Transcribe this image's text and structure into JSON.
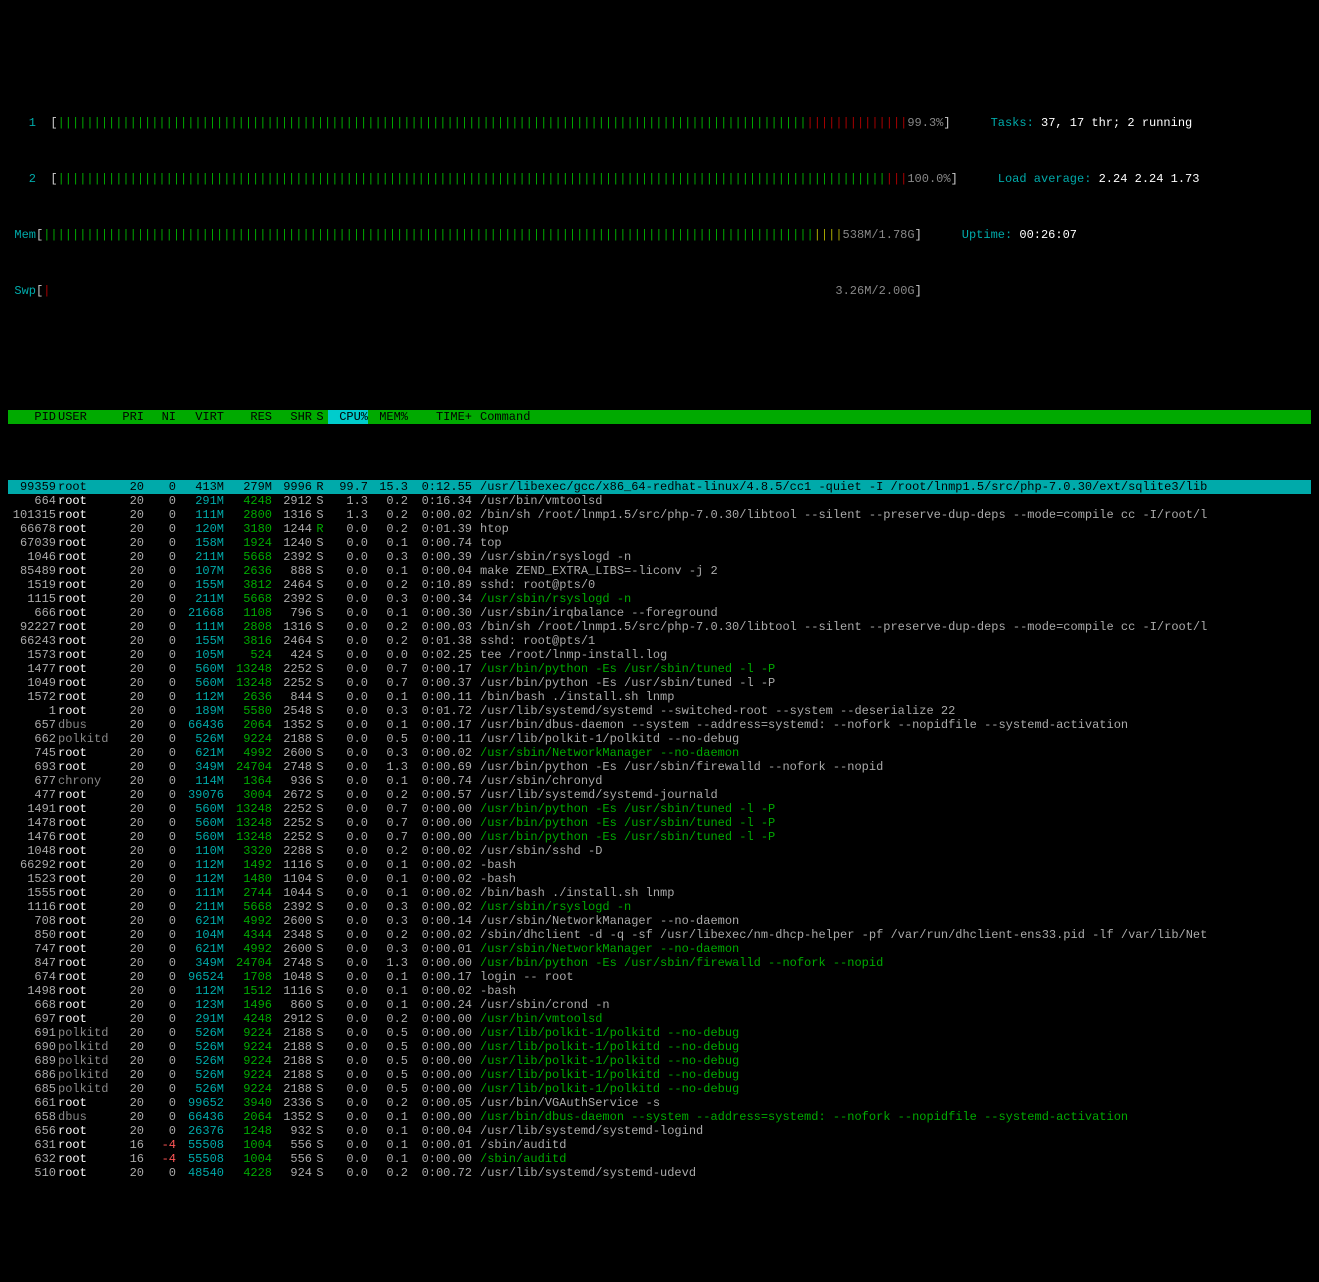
{
  "meters": {
    "cpu1": {
      "label": "1",
      "green_bars": 104,
      "red_bars": 14,
      "value": "99.3%"
    },
    "cpu2": {
      "label": "2",
      "green_bars": 115,
      "red_bars": 3,
      "value": "100.0%"
    },
    "mem": {
      "label": "Mem",
      "green_bars": 107,
      "blue_bars": 0,
      "yellow_bars": 4,
      "value": "538M/1.78G"
    },
    "swp": {
      "label": "Swp",
      "red_bars": 1,
      "value": "3.26M/2.00G"
    }
  },
  "stats": {
    "tasks": "Tasks: ",
    "tasks_val": "37, 17 thr; 2 running",
    "load": "Load average: ",
    "load_val": "2.24 2.24 1.73",
    "uptime": "Uptime: ",
    "uptime_val": "00:26:07"
  },
  "headers": [
    "PID",
    "USER",
    "PRI",
    "NI",
    "VIRT",
    "RES",
    "SHR",
    "S",
    "CPU%",
    "MEM%",
    "TIME+",
    "Command"
  ],
  "processes": [
    {
      "pid": "99359",
      "user": "root",
      "pri": "20",
      "ni": "0",
      "virt": "413M",
      "res": "279M",
      "shr": "9996",
      "s": "R",
      "cpu": "99.7",
      "mem": "15.3",
      "time": "0:12.55",
      "cmd": "/usr/libexec/gcc/x86_64-redhat-linux/4.8.5/cc1 -quiet -I /root/lnmp1.5/src/php-7.0.30/ext/sqlite3/lib",
      "cmdclass": "white",
      "selected": true
    },
    {
      "pid": "664",
      "user": "root",
      "pri": "20",
      "ni": "0",
      "virt": "291M",
      "res": "4248",
      "shr": "2912",
      "s": "S",
      "cpu": "1.3",
      "mem": "0.2",
      "time": "0:16.34",
      "cmd": "/usr/bin/vmtoolsd",
      "cmdclass": "white"
    },
    {
      "pid": "101315",
      "user": "root",
      "pri": "20",
      "ni": "0",
      "virt": "111M",
      "res": "2800",
      "shr": "1316",
      "s": "S",
      "cpu": "1.3",
      "mem": "0.2",
      "time": "0:00.02",
      "cmd": "/bin/sh /root/lnmp1.5/src/php-7.0.30/libtool --silent --preserve-dup-deps --mode=compile cc -I/root/l",
      "cmdclass": "white"
    },
    {
      "pid": "66678",
      "user": "root",
      "pri": "20",
      "ni": "0",
      "virt": "120M",
      "res": "3180",
      "shr": "1244",
      "s": "R",
      "cpu": "0.0",
      "mem": "0.2",
      "time": "0:01.39",
      "cmd": "htop",
      "cmdclass": "white",
      "running": true
    },
    {
      "pid": "67039",
      "user": "root",
      "pri": "20",
      "ni": "0",
      "virt": "158M",
      "res": "1924",
      "shr": "1240",
      "s": "S",
      "cpu": "0.0",
      "mem": "0.1",
      "time": "0:00.74",
      "cmd": "top",
      "cmdclass": "white"
    },
    {
      "pid": "1046",
      "user": "root",
      "pri": "20",
      "ni": "0",
      "virt": "211M",
      "res": "5668",
      "shr": "2392",
      "s": "S",
      "cpu": "0.0",
      "mem": "0.3",
      "time": "0:00.39",
      "cmd": "/usr/sbin/rsyslogd -n",
      "cmdclass": "white"
    },
    {
      "pid": "85489",
      "user": "root",
      "pri": "20",
      "ni": "0",
      "virt": "107M",
      "res": "2636",
      "shr": "888",
      "s": "S",
      "cpu": "0.0",
      "mem": "0.1",
      "time": "0:00.04",
      "cmd": "make ZEND_EXTRA_LIBS=-liconv -j 2",
      "cmdclass": "white"
    },
    {
      "pid": "1519",
      "user": "root",
      "pri": "20",
      "ni": "0",
      "virt": "155M",
      "res": "3812",
      "shr": "2464",
      "s": "S",
      "cpu": "0.0",
      "mem": "0.2",
      "time": "0:10.89",
      "cmd": "sshd: root@pts/0",
      "cmdclass": "white"
    },
    {
      "pid": "1115",
      "user": "root",
      "pri": "20",
      "ni": "0",
      "virt": "211M",
      "res": "5668",
      "shr": "2392",
      "s": "S",
      "cpu": "0.0",
      "mem": "0.3",
      "time": "0:00.34",
      "cmd": "/usr/sbin/rsyslogd -n",
      "cmdclass": "green"
    },
    {
      "pid": "666",
      "user": "root",
      "pri": "20",
      "ni": "0",
      "virt": "21668",
      "res": "1108",
      "shr": "796",
      "s": "S",
      "cpu": "0.0",
      "mem": "0.1",
      "time": "0:00.30",
      "cmd": "/usr/sbin/irqbalance --foreground",
      "cmdclass": "white"
    },
    {
      "pid": "92227",
      "user": "root",
      "pri": "20",
      "ni": "0",
      "virt": "111M",
      "res": "2808",
      "shr": "1316",
      "s": "S",
      "cpu": "0.0",
      "mem": "0.2",
      "time": "0:00.03",
      "cmd": "/bin/sh /root/lnmp1.5/src/php-7.0.30/libtool --silent --preserve-dup-deps --mode=compile cc -I/root/l",
      "cmdclass": "white"
    },
    {
      "pid": "66243",
      "user": "root",
      "pri": "20",
      "ni": "0",
      "virt": "155M",
      "res": "3816",
      "shr": "2464",
      "s": "S",
      "cpu": "0.0",
      "mem": "0.2",
      "time": "0:01.38",
      "cmd": "sshd: root@pts/1",
      "cmdclass": "white"
    },
    {
      "pid": "1573",
      "user": "root",
      "pri": "20",
      "ni": "0",
      "virt": "105M",
      "res": "524",
      "shr": "424",
      "s": "S",
      "cpu": "0.0",
      "mem": "0.0",
      "time": "0:02.25",
      "cmd": "tee /root/lnmp-install.log",
      "cmdclass": "white"
    },
    {
      "pid": "1477",
      "user": "root",
      "pri": "20",
      "ni": "0",
      "virt": "560M",
      "res": "13248",
      "shr": "2252",
      "s": "S",
      "cpu": "0.0",
      "mem": "0.7",
      "time": "0:00.17",
      "cmd": "/usr/bin/python -Es /usr/sbin/tuned -l -P",
      "cmdclass": "green"
    },
    {
      "pid": "1049",
      "user": "root",
      "pri": "20",
      "ni": "0",
      "virt": "560M",
      "res": "13248",
      "shr": "2252",
      "s": "S",
      "cpu": "0.0",
      "mem": "0.7",
      "time": "0:00.37",
      "cmd": "/usr/bin/python -Es /usr/sbin/tuned -l -P",
      "cmdclass": "white"
    },
    {
      "pid": "1572",
      "user": "root",
      "pri": "20",
      "ni": "0",
      "virt": "112M",
      "res": "2636",
      "shr": "844",
      "s": "S",
      "cpu": "0.0",
      "mem": "0.1",
      "time": "0:00.11",
      "cmd": "/bin/bash ./install.sh lnmp",
      "cmdclass": "white"
    },
    {
      "pid": "1",
      "user": "root",
      "pri": "20",
      "ni": "0",
      "virt": "189M",
      "res": "5580",
      "shr": "2548",
      "s": "S",
      "cpu": "0.0",
      "mem": "0.3",
      "time": "0:01.72",
      "cmd": "/usr/lib/systemd/systemd --switched-root --system --deserialize 22",
      "cmdclass": "white"
    },
    {
      "pid": "657",
      "user": "dbus",
      "pri": "20",
      "ni": "0",
      "virt": "66436",
      "res": "2064",
      "shr": "1352",
      "s": "S",
      "cpu": "0.0",
      "mem": "0.1",
      "time": "0:00.17",
      "cmd": "/usr/bin/dbus-daemon --system --address=systemd: --nofork --nopidfile --systemd-activation",
      "cmdclass": "white"
    },
    {
      "pid": "662",
      "user": "polkitd",
      "pri": "20",
      "ni": "0",
      "virt": "526M",
      "res": "9224",
      "shr": "2188",
      "s": "S",
      "cpu": "0.0",
      "mem": "0.5",
      "time": "0:00.11",
      "cmd": "/usr/lib/polkit-1/polkitd --no-debug",
      "cmdclass": "white"
    },
    {
      "pid": "745",
      "user": "root",
      "pri": "20",
      "ni": "0",
      "virt": "621M",
      "res": "4992",
      "shr": "2600",
      "s": "S",
      "cpu": "0.0",
      "mem": "0.3",
      "time": "0:00.02",
      "cmd": "/usr/sbin/NetworkManager --no-daemon",
      "cmdclass": "green"
    },
    {
      "pid": "693",
      "user": "root",
      "pri": "20",
      "ni": "0",
      "virt": "349M",
      "res": "24704",
      "shr": "2748",
      "s": "S",
      "cpu": "0.0",
      "mem": "1.3",
      "time": "0:00.69",
      "cmd": "/usr/bin/python -Es /usr/sbin/firewalld --nofork --nopid",
      "cmdclass": "white"
    },
    {
      "pid": "677",
      "user": "chrony",
      "pri": "20",
      "ni": "0",
      "virt": "114M",
      "res": "1364",
      "shr": "936",
      "s": "S",
      "cpu": "0.0",
      "mem": "0.1",
      "time": "0:00.74",
      "cmd": "/usr/sbin/chronyd",
      "cmdclass": "white"
    },
    {
      "pid": "477",
      "user": "root",
      "pri": "20",
      "ni": "0",
      "virt": "39076",
      "res": "3004",
      "shr": "2672",
      "s": "S",
      "cpu": "0.0",
      "mem": "0.2",
      "time": "0:00.57",
      "cmd": "/usr/lib/systemd/systemd-journald",
      "cmdclass": "white"
    },
    {
      "pid": "1491",
      "user": "root",
      "pri": "20",
      "ni": "0",
      "virt": "560M",
      "res": "13248",
      "shr": "2252",
      "s": "S",
      "cpu": "0.0",
      "mem": "0.7",
      "time": "0:00.00",
      "cmd": "/usr/bin/python -Es /usr/sbin/tuned -l -P",
      "cmdclass": "green"
    },
    {
      "pid": "1478",
      "user": "root",
      "pri": "20",
      "ni": "0",
      "virt": "560M",
      "res": "13248",
      "shr": "2252",
      "s": "S",
      "cpu": "0.0",
      "mem": "0.7",
      "time": "0:00.00",
      "cmd": "/usr/bin/python -Es /usr/sbin/tuned -l -P",
      "cmdclass": "green"
    },
    {
      "pid": "1476",
      "user": "root",
      "pri": "20",
      "ni": "0",
      "virt": "560M",
      "res": "13248",
      "shr": "2252",
      "s": "S",
      "cpu": "0.0",
      "mem": "0.7",
      "time": "0:00.00",
      "cmd": "/usr/bin/python -Es /usr/sbin/tuned -l -P",
      "cmdclass": "green"
    },
    {
      "pid": "1048",
      "user": "root",
      "pri": "20",
      "ni": "0",
      "virt": "110M",
      "res": "3320",
      "shr": "2288",
      "s": "S",
      "cpu": "0.0",
      "mem": "0.2",
      "time": "0:00.02",
      "cmd": "/usr/sbin/sshd -D",
      "cmdclass": "white"
    },
    {
      "pid": "66292",
      "user": "root",
      "pri": "20",
      "ni": "0",
      "virt": "112M",
      "res": "1492",
      "shr": "1116",
      "s": "S",
      "cpu": "0.0",
      "mem": "0.1",
      "time": "0:00.02",
      "cmd": "-bash",
      "cmdclass": "white"
    },
    {
      "pid": "1523",
      "user": "root",
      "pri": "20",
      "ni": "0",
      "virt": "112M",
      "res": "1480",
      "shr": "1104",
      "s": "S",
      "cpu": "0.0",
      "mem": "0.1",
      "time": "0:00.02",
      "cmd": "-bash",
      "cmdclass": "white"
    },
    {
      "pid": "1555",
      "user": "root",
      "pri": "20",
      "ni": "0",
      "virt": "111M",
      "res": "2744",
      "shr": "1044",
      "s": "S",
      "cpu": "0.0",
      "mem": "0.1",
      "time": "0:00.02",
      "cmd": "/bin/bash ./install.sh lnmp",
      "cmdclass": "white"
    },
    {
      "pid": "1116",
      "user": "root",
      "pri": "20",
      "ni": "0",
      "virt": "211M",
      "res": "5668",
      "shr": "2392",
      "s": "S",
      "cpu": "0.0",
      "mem": "0.3",
      "time": "0:00.02",
      "cmd": "/usr/sbin/rsyslogd -n",
      "cmdclass": "green"
    },
    {
      "pid": "708",
      "user": "root",
      "pri": "20",
      "ni": "0",
      "virt": "621M",
      "res": "4992",
      "shr": "2600",
      "s": "S",
      "cpu": "0.0",
      "mem": "0.3",
      "time": "0:00.14",
      "cmd": "/usr/sbin/NetworkManager --no-daemon",
      "cmdclass": "white"
    },
    {
      "pid": "850",
      "user": "root",
      "pri": "20",
      "ni": "0",
      "virt": "104M",
      "res": "4344",
      "shr": "2348",
      "s": "S",
      "cpu": "0.0",
      "mem": "0.2",
      "time": "0:00.02",
      "cmd": "/sbin/dhclient -d -q -sf /usr/libexec/nm-dhcp-helper -pf /var/run/dhclient-ens33.pid -lf /var/lib/Net",
      "cmdclass": "white"
    },
    {
      "pid": "747",
      "user": "root",
      "pri": "20",
      "ni": "0",
      "virt": "621M",
      "res": "4992",
      "shr": "2600",
      "s": "S",
      "cpu": "0.0",
      "mem": "0.3",
      "time": "0:00.01",
      "cmd": "/usr/sbin/NetworkManager --no-daemon",
      "cmdclass": "green"
    },
    {
      "pid": "847",
      "user": "root",
      "pri": "20",
      "ni": "0",
      "virt": "349M",
      "res": "24704",
      "shr": "2748",
      "s": "S",
      "cpu": "0.0",
      "mem": "1.3",
      "time": "0:00.00",
      "cmd": "/usr/bin/python -Es /usr/sbin/firewalld --nofork --nopid",
      "cmdclass": "green"
    },
    {
      "pid": "674",
      "user": "root",
      "pri": "20",
      "ni": "0",
      "virt": "96524",
      "res": "1708",
      "shr": "1048",
      "s": "S",
      "cpu": "0.0",
      "mem": "0.1",
      "time": "0:00.17",
      "cmd": "login -- root",
      "cmdclass": "white"
    },
    {
      "pid": "1498",
      "user": "root",
      "pri": "20",
      "ni": "0",
      "virt": "112M",
      "res": "1512",
      "shr": "1116",
      "s": "S",
      "cpu": "0.0",
      "mem": "0.1",
      "time": "0:00.02",
      "cmd": "-bash",
      "cmdclass": "white"
    },
    {
      "pid": "668",
      "user": "root",
      "pri": "20",
      "ni": "0",
      "virt": "123M",
      "res": "1496",
      "shr": "860",
      "s": "S",
      "cpu": "0.0",
      "mem": "0.1",
      "time": "0:00.24",
      "cmd": "/usr/sbin/crond -n",
      "cmdclass": "white"
    },
    {
      "pid": "697",
      "user": "root",
      "pri": "20",
      "ni": "0",
      "virt": "291M",
      "res": "4248",
      "shr": "2912",
      "s": "S",
      "cpu": "0.0",
      "mem": "0.2",
      "time": "0:00.00",
      "cmd": "/usr/bin/vmtoolsd",
      "cmdclass": "green"
    },
    {
      "pid": "691",
      "user": "polkitd",
      "pri": "20",
      "ni": "0",
      "virt": "526M",
      "res": "9224",
      "shr": "2188",
      "s": "S",
      "cpu": "0.0",
      "mem": "0.5",
      "time": "0:00.00",
      "cmd": "/usr/lib/polkit-1/polkitd --no-debug",
      "cmdclass": "green"
    },
    {
      "pid": "690",
      "user": "polkitd",
      "pri": "20",
      "ni": "0",
      "virt": "526M",
      "res": "9224",
      "shr": "2188",
      "s": "S",
      "cpu": "0.0",
      "mem": "0.5",
      "time": "0:00.00",
      "cmd": "/usr/lib/polkit-1/polkitd --no-debug",
      "cmdclass": "green"
    },
    {
      "pid": "689",
      "user": "polkitd",
      "pri": "20",
      "ni": "0",
      "virt": "526M",
      "res": "9224",
      "shr": "2188",
      "s": "S",
      "cpu": "0.0",
      "mem": "0.5",
      "time": "0:00.00",
      "cmd": "/usr/lib/polkit-1/polkitd --no-debug",
      "cmdclass": "green"
    },
    {
      "pid": "686",
      "user": "polkitd",
      "pri": "20",
      "ni": "0",
      "virt": "526M",
      "res": "9224",
      "shr": "2188",
      "s": "S",
      "cpu": "0.0",
      "mem": "0.5",
      "time": "0:00.00",
      "cmd": "/usr/lib/polkit-1/polkitd --no-debug",
      "cmdclass": "green"
    },
    {
      "pid": "685",
      "user": "polkitd",
      "pri": "20",
      "ni": "0",
      "virt": "526M",
      "res": "9224",
      "shr": "2188",
      "s": "S",
      "cpu": "0.0",
      "mem": "0.5",
      "time": "0:00.00",
      "cmd": "/usr/lib/polkit-1/polkitd --no-debug",
      "cmdclass": "green"
    },
    {
      "pid": "661",
      "user": "root",
      "pri": "20",
      "ni": "0",
      "virt": "99652",
      "res": "3940",
      "shr": "2336",
      "s": "S",
      "cpu": "0.0",
      "mem": "0.2",
      "time": "0:00.05",
      "cmd": "/usr/bin/VGAuthService -s",
      "cmdclass": "white"
    },
    {
      "pid": "658",
      "user": "dbus",
      "pri": "20",
      "ni": "0",
      "virt": "66436",
      "res": "2064",
      "shr": "1352",
      "s": "S",
      "cpu": "0.0",
      "mem": "0.1",
      "time": "0:00.00",
      "cmd": "/usr/bin/dbus-daemon --system --address=systemd: --nofork --nopidfile --systemd-activation",
      "cmdclass": "green"
    },
    {
      "pid": "656",
      "user": "root",
      "pri": "20",
      "ni": "0",
      "virt": "26376",
      "res": "1248",
      "shr": "932",
      "s": "S",
      "cpu": "0.0",
      "mem": "0.1",
      "time": "0:00.04",
      "cmd": "/usr/lib/systemd/systemd-logind",
      "cmdclass": "white"
    },
    {
      "pid": "631",
      "user": "root",
      "pri": "16",
      "ni": "-4",
      "virt": "55508",
      "res": "1004",
      "shr": "556",
      "s": "S",
      "cpu": "0.0",
      "mem": "0.1",
      "time": "0:00.01",
      "cmd": "/sbin/auditd",
      "cmdclass": "white",
      "ni_red": true
    },
    {
      "pid": "632",
      "user": "root",
      "pri": "16",
      "ni": "-4",
      "virt": "55508",
      "res": "1004",
      "shr": "556",
      "s": "S",
      "cpu": "0.0",
      "mem": "0.1",
      "time": "0:00.00",
      "cmd": "/sbin/auditd",
      "cmdclass": "green",
      "ni_red": true
    },
    {
      "pid": "510",
      "user": "root",
      "pri": "20",
      "ni": "0",
      "virt": "48540",
      "res": "4228",
      "shr": "924",
      "s": "S",
      "cpu": "0.0",
      "mem": "0.2",
      "time": "0:00.72",
      "cmd": "/usr/lib/systemd/systemd-udevd",
      "cmdclass": "white"
    }
  ]
}
